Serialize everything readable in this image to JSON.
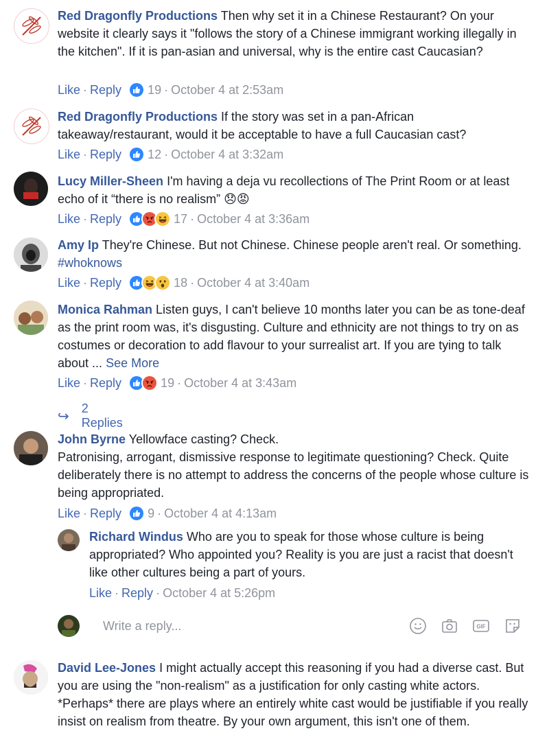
{
  "comments": [
    {
      "name": "Red Dragonfly Productions",
      "text": "Then why set it in a Chinese Restaurant? On your website it clearly says it \"follows the story of a Chinese immigrant working illegally in the kitchen\". If it is pan-asian and universal, why is the entire cast Caucasian?",
      "like": "Like",
      "reply": "Reply",
      "count": "19",
      "time": "October 4 at 2:53am"
    },
    {
      "name": "Red Dragonfly Productions",
      "text": "If the story was set in a pan-African takeaway/restaurant, would it be acceptable to have a full Caucasian cast?",
      "like": "Like",
      "reply": "Reply",
      "count": "12",
      "time": "October 4 at 3:32am"
    },
    {
      "name": "Lucy Miller-Sheen",
      "text": "I'm having a deja vu recollections of The Print Room or at least echo of it “there is no realism”",
      "emoji": "😞😡",
      "like": "Like",
      "reply": "Reply",
      "count": "17",
      "time": "October 4 at 3:36am"
    },
    {
      "name": "Amy Ip",
      "text": "They're Chinese. But not Chinese. Chinese people aren't real. Or something.",
      "hashtag": "#whoknows",
      "like": "Like",
      "reply": "Reply",
      "count": "18",
      "time": "October 4 at 3:40am"
    },
    {
      "name": "Monica Rahman",
      "text": "Listen guys, I can't believe 10 months later you can be as tone-deaf as the print room was, it's disgusting. Culture and ethnicity are not things to try on as costumes or decoration to add flavour to your surrealist art. If you are tying to talk about ...",
      "see_more": "See More",
      "like": "Like",
      "reply": "Reply",
      "count": "19",
      "time": "October 4 at 3:43am",
      "replies_label": "2 Replies"
    },
    {
      "name": "John Byrne",
      "text": "Yellowface casting? Check.",
      "text2": "Patronising, arrogant, dismissive response to legitimate questioning? Check. Quite deliberately there is no attempt to address the concerns of the people whose culture is being appropriated.",
      "like": "Like",
      "reply": "Reply",
      "count": "9",
      "time": "October 4 at 4:13am"
    },
    {
      "name": "Richard Windus",
      "text": "Who are you to speak for those whose culture is being appropriated? Who appointed you? Reality is you are just a racist that doesn't like other cultures being a part of yours.",
      "like": "Like",
      "reply": "Reply",
      "time": "October 4 at 5:26pm"
    },
    {
      "name": "David Lee-Jones",
      "text": "I might actually accept this reasoning if you had a diverse cast. But you are using the \"non-realism\" as a justification for only casting white actors. *Perhaps* there are plays where an entirely white cast would be justifiable if you really insist on realism from theatre. By your own argument, this isn't one of them."
    }
  ],
  "reply_box": {
    "placeholder": "Write a reply..."
  },
  "icons": {
    "like_reaction": "like-reaction-icon",
    "haha_reaction": "haha-reaction-icon",
    "wow_reaction": "wow-reaction-icon",
    "angry_reaction": "angry-reaction-icon",
    "replies_arrow": "reply-arrow-icon",
    "emoji": "emoji-icon",
    "camera": "camera-icon",
    "gif": "gif-icon",
    "sticker": "sticker-icon"
  },
  "colors": {
    "link": "#365899",
    "action": "#4267b2",
    "meta": "#90949c",
    "like_blue": "#2d88ff",
    "angry_red": "#e9543f"
  }
}
